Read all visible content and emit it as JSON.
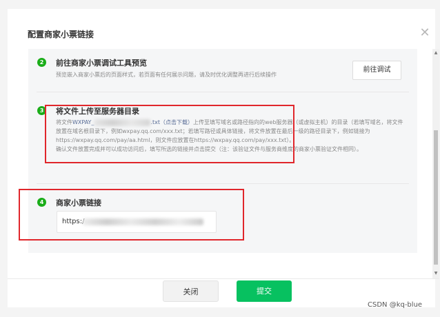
{
  "dialog": {
    "title": "配置商家小票链接",
    "close_glyph": "✕"
  },
  "step2": {
    "number": "2",
    "title": "前往商家小票调试工具预览",
    "desc": "预览嵌入商家小票后的页面样式，若页面有任何展示问题，请及时优化调整再进行后续操作",
    "button": "前往调试"
  },
  "step3": {
    "number": "3",
    "title": "将文件上传至服务器目录",
    "desc_prefix": "将文件",
    "file_link_start": "WXPAY_",
    "file_ext": ".txt",
    "download_link": "（点击下载）",
    "desc_rest": "上传至填写域名或路径指向的web服务器（或虚拟主机）的目录（若填写域名，将文件放置在域名根目录下，例如wxpay.qq.com/xxx.txt；若填写路径或具体链接，将文件放置在最后一级的路径目录下，例如链接为https://wxpay.qq.com/pay/aa.html，则文件应放置在https://wxpay.qq.com/pay/xxx.txt）。",
    "desc_confirm": "确认文件放置完成并可以成功访问后，填写所选的链接并点击提交（注：该验证文件与服务商维度的商家小票验证文件相同）。"
  },
  "step4": {
    "number": "4",
    "title": "商家小票链接",
    "input_prefix": "https:/"
  },
  "footer": {
    "close_label": "关闭",
    "submit_label": "提交"
  },
  "watermark": "CSDN @kq-blue",
  "colors": {
    "accent_green": "#07c160",
    "badge_green": "#1aad19",
    "link_blue": "#576b95",
    "highlight_red": "#e0262b"
  }
}
